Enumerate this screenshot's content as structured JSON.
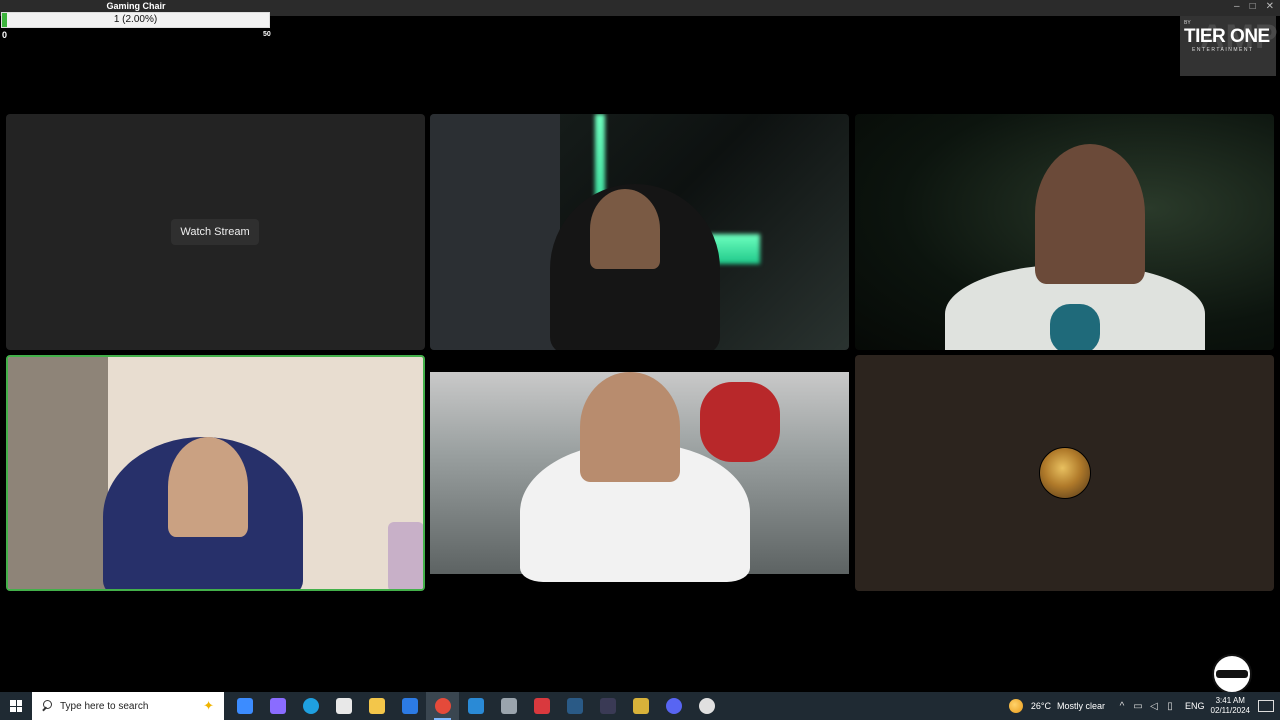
{
  "goal": {
    "title": "Gaming Chair",
    "value_text": "1 (2.00%)",
    "progress_fraction": 0.02,
    "min": "0",
    "max": "50"
  },
  "logo": {
    "by": "BY",
    "main": "TIER ONE",
    "sub": "ENTERTAINMENT",
    "ghost": "AMP"
  },
  "tiles": {
    "watch_stream": "Watch Stream"
  },
  "taskbar": {
    "search_placeholder": "Type here to search",
    "apps": [
      {
        "icon": "copilot-icon",
        "color": "#3c8cff"
      },
      {
        "icon": "copilot-alt-icon",
        "color": "#8a6cff"
      },
      {
        "icon": "edge-icon",
        "color": "#1fa0e0"
      },
      {
        "icon": "store-icon",
        "color": "#e8e8e8"
      },
      {
        "icon": "file-explorer-icon",
        "color": "#f3c64a"
      },
      {
        "icon": "mail-icon",
        "color": "#2c7be5"
      },
      {
        "icon": "chrome-icon",
        "color": "#e54a3a"
      },
      {
        "icon": "app-blue-icon",
        "color": "#2a8ad6"
      },
      {
        "icon": "app-gray-icon",
        "color": "#9aa4ad"
      },
      {
        "icon": "app-red-icon",
        "color": "#d9393e"
      },
      {
        "icon": "steam-icon",
        "color": "#2a5a86"
      },
      {
        "icon": "app-dark-icon",
        "color": "#3a3a55"
      },
      {
        "icon": "app-yellow-icon",
        "color": "#d8b23a"
      },
      {
        "icon": "discord-icon",
        "color": "#5865f2"
      },
      {
        "icon": "obs-icon",
        "color": "#e0e0e0"
      }
    ],
    "weather_temp": "26°C",
    "weather_cond": "Mostly clear",
    "lang": "ENG",
    "time": "3:41 AM",
    "date": "02/11/2024"
  },
  "colors": {
    "active_speaker_border": "#43b04a",
    "goal_fill": "#3cb43c",
    "taskbar_bg": "#1f2a33"
  }
}
